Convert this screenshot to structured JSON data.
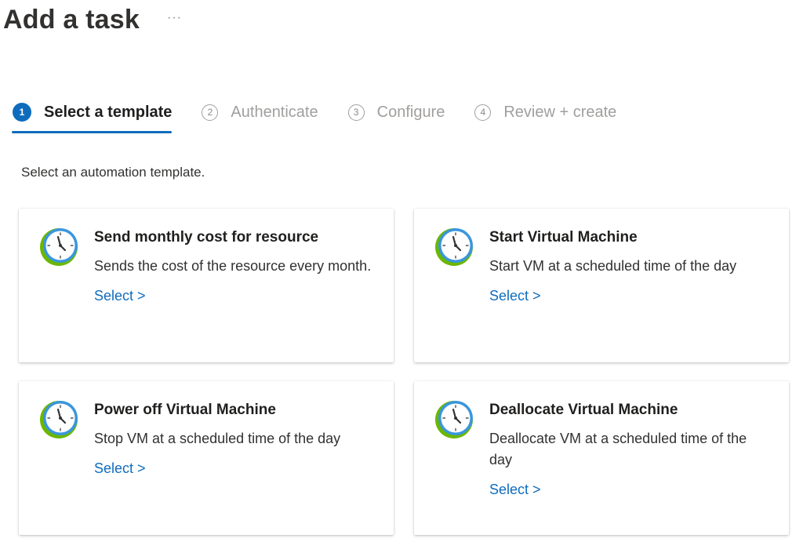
{
  "header": {
    "title": "Add a task",
    "more_label": "···"
  },
  "steps": [
    {
      "number": "1",
      "label": "Select a template",
      "active": true
    },
    {
      "number": "2",
      "label": "Authenticate",
      "active": false
    },
    {
      "number": "3",
      "label": "Configure",
      "active": false
    },
    {
      "number": "4",
      "label": "Review + create",
      "active": false
    }
  ],
  "intro": "Select an automation template.",
  "templates": [
    {
      "title": "Send monthly cost for resource",
      "description": "Sends the cost of the resource every month.",
      "link": "Select >",
      "icon": "clock-icon"
    },
    {
      "title": "Start Virtual Machine",
      "description": "Start VM at a scheduled time of the day",
      "link": "Select >",
      "icon": "clock-icon"
    },
    {
      "title": "Power off Virtual Machine",
      "description": "Stop VM at a scheduled time of the day",
      "link": "Select >",
      "icon": "clock-icon"
    },
    {
      "title": "Deallocate Virtual Machine",
      "description": "Deallocate VM at a scheduled time of the day",
      "link": "Select >",
      "icon": "clock-icon"
    }
  ],
  "colors": {
    "accent": "#0f6cbd",
    "icon_green": "#6bb700",
    "icon_blue": "#3a96dd"
  }
}
